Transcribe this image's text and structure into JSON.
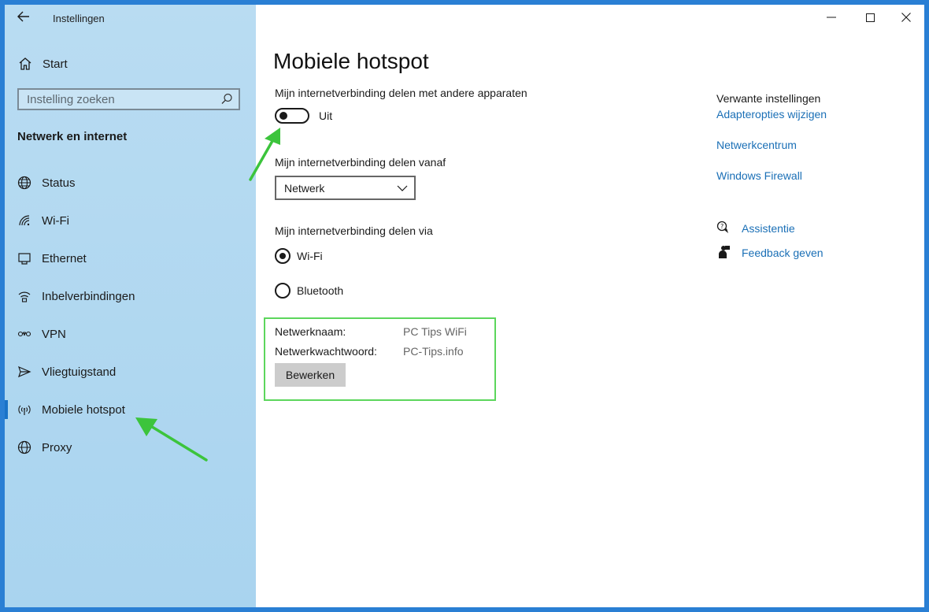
{
  "window": {
    "title": "Instellingen"
  },
  "sidebar": {
    "home_label": "Start",
    "search_placeholder": "Instelling zoeken",
    "section_title": "Netwerk en internet",
    "items": [
      {
        "label": "Status",
        "icon": "globe-icon"
      },
      {
        "label": "Wi-Fi",
        "icon": "wifi-icon"
      },
      {
        "label": "Ethernet",
        "icon": "ethernet-icon"
      },
      {
        "label": "Inbelverbindingen",
        "icon": "dialup-icon"
      },
      {
        "label": "VPN",
        "icon": "vpn-icon"
      },
      {
        "label": "Vliegtuigstand",
        "icon": "airplane-icon"
      },
      {
        "label": "Mobiele hotspot",
        "icon": "hotspot-icon",
        "active": true
      },
      {
        "label": "Proxy",
        "icon": "globe-icon"
      }
    ]
  },
  "main": {
    "title": "Mobiele hotspot",
    "share_label": "Mijn internetverbinding delen met andere apparaten",
    "toggle_state": "Uit",
    "share_from_label": "Mijn internetverbinding delen vanaf",
    "share_from_value": "Netwerk",
    "share_via_label": "Mijn internetverbinding delen via",
    "via_options": [
      {
        "label": "Wi-Fi",
        "checked": true
      },
      {
        "label": "Bluetooth",
        "checked": false
      }
    ],
    "network_name_label": "Netwerknaam:",
    "network_name_value": "PC Tips WiFi",
    "network_password_label": "Netwerkwachtwoord:",
    "network_password_value": "PC-Tips.info",
    "edit_button": "Bewerken"
  },
  "related": {
    "title": "Verwante instellingen",
    "links": [
      "Adapteropties wijzigen",
      "Netwerkcentrum",
      "Windows Firewall"
    ]
  },
  "help": {
    "assist_label": "Assistentie",
    "feedback_label": "Feedback geven"
  },
  "colors": {
    "accent": "#1a73c8",
    "link": "#1a6fb6",
    "annotation": "#3cc43c",
    "sidebar_bg": "#b9dcf2"
  }
}
